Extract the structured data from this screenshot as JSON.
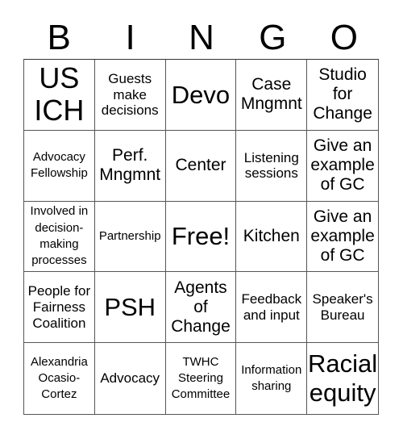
{
  "header": [
    "B",
    "I",
    "N",
    "G",
    "O"
  ],
  "cells": [
    {
      "text": "US ICH",
      "size": "s-xl"
    },
    {
      "text": "Guests make decisions",
      "size": "s-s"
    },
    {
      "text": "Devo",
      "size": "s-l"
    },
    {
      "text": "Case Mngmnt",
      "size": "s-m"
    },
    {
      "text": "Studio for Change",
      "size": "s-m"
    },
    {
      "text": "Advocacy Fellowship",
      "size": "s-xs"
    },
    {
      "text": "Perf. Mngmnt",
      "size": "s-m"
    },
    {
      "text": "Center",
      "size": "s-m"
    },
    {
      "text": "Listening sessions",
      "size": "s-s"
    },
    {
      "text": "Give an example of GC",
      "size": "s-m"
    },
    {
      "text": "Involved in decision-making processes",
      "size": "s-xs"
    },
    {
      "text": "Partnership",
      "size": "s-xs"
    },
    {
      "text": "Free!",
      "size": "s-l"
    },
    {
      "text": "Kitchen",
      "size": "s-m"
    },
    {
      "text": "Give an example of GC",
      "size": "s-m"
    },
    {
      "text": "People for Fairness Coalition",
      "size": "s-s"
    },
    {
      "text": "PSH",
      "size": "s-l"
    },
    {
      "text": "Agents of Change",
      "size": "s-m"
    },
    {
      "text": "Feedback and input",
      "size": "s-s"
    },
    {
      "text": "Speaker's Bureau",
      "size": "s-s"
    },
    {
      "text": "Alexandria Ocasio-Cortez",
      "size": "s-xs"
    },
    {
      "text": "Advocacy",
      "size": "s-s"
    },
    {
      "text": "TWHC Steering Committee",
      "size": "s-xs"
    },
    {
      "text": "Information sharing",
      "size": "s-xs"
    },
    {
      "text": "Racial equity",
      "size": "s-l"
    }
  ]
}
